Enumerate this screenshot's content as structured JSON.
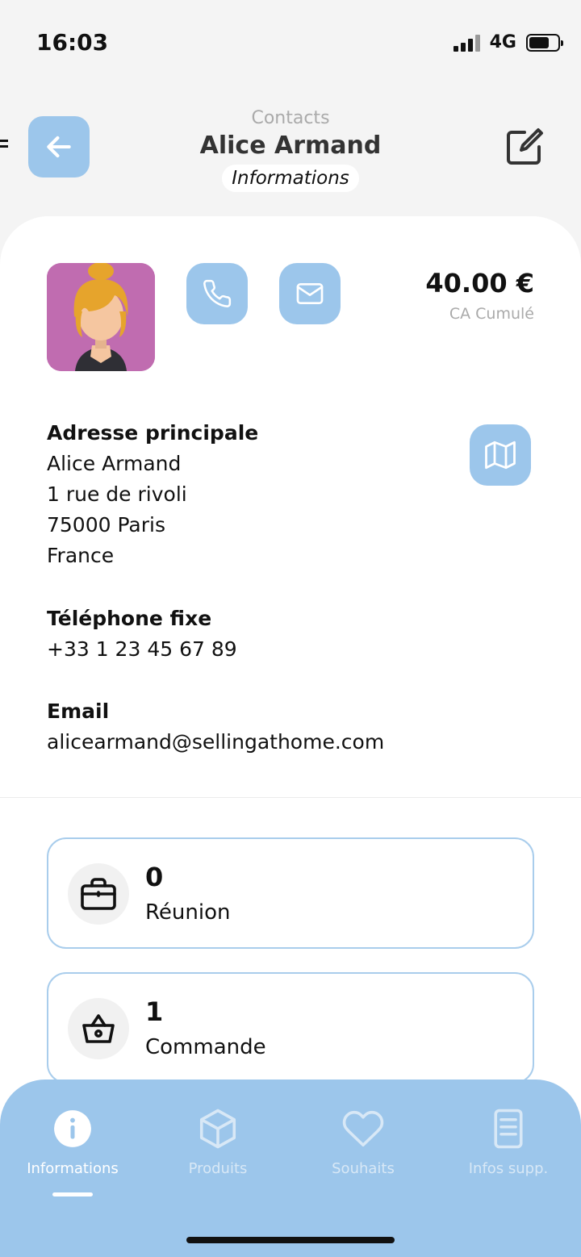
{
  "status_bar": {
    "time": "16:03",
    "network": "4G"
  },
  "header": {
    "breadcrumb": "Contacts",
    "title": "Alice Armand",
    "subtitle": "Informations"
  },
  "profile": {
    "ca_value": "40.00 €",
    "ca_label": "CA Cumulé"
  },
  "address": {
    "label": "Adresse principale",
    "name": "Alice Armand",
    "street": "1 rue de rivoli",
    "city": "75000 Paris",
    "country": "France"
  },
  "phone": {
    "label": "Téléphone fixe",
    "value": "+33 1 23 45 67 89"
  },
  "email": {
    "label": "Email",
    "value": "alicearmand@sellingathome.com"
  },
  "stats": [
    {
      "count": "0",
      "label": "Réunion",
      "icon": "briefcase-icon"
    },
    {
      "count": "1",
      "label": "Commande",
      "icon": "basket-icon"
    }
  ],
  "tabs": [
    {
      "label": "Informations",
      "icon": "info-icon",
      "active": true
    },
    {
      "label": "Produits",
      "icon": "box-icon",
      "active": false
    },
    {
      "label": "Souhaits",
      "icon": "heart-icon",
      "active": false
    },
    {
      "label": "Infos supp.",
      "icon": "document-icon",
      "active": false
    }
  ],
  "colors": {
    "accent": "#9cc6eb",
    "card_border": "#a9cdec",
    "background": "#f4f4f4"
  }
}
